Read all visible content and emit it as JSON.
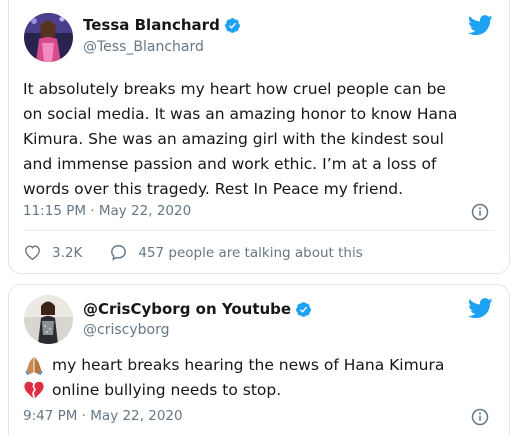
{
  "tweets": [
    {
      "display_name": "Tessa Blanchard",
      "handle": "@Tess_Blanchard",
      "verified": true,
      "body_lines": [
        "It absolutely breaks my heart how cruel people can be",
        "on social media. It was an amazing honor to know Hana",
        "Kimura. She was an amazing girl with the kindest soul",
        "and immense passion and work ethic. I’m at a loss of",
        "words over this tragedy. Rest In Peace my friend."
      ],
      "timestamp": "11:15 PM · May 22, 2020",
      "likes": "3.2K",
      "replies_text": "457 people are talking about this"
    },
    {
      "display_name": "@CrisCyborg on Youtube",
      "handle": "@criscyborg",
      "verified": true,
      "body_lines": [
        "my heart breaks hearing the news of Hana Kimura",
        "online bullying needs to stop."
      ],
      "line_emojis": [
        "folded-hands-emoji",
        "broken-heart-emoji"
      ],
      "timestamp": "9:47 PM · May 22, 2020"
    }
  ],
  "colors": {
    "twitter_blue": "#1da1f2",
    "text_primary": "#14171a",
    "text_secondary": "#657786",
    "border": "#dfe5ea"
  }
}
